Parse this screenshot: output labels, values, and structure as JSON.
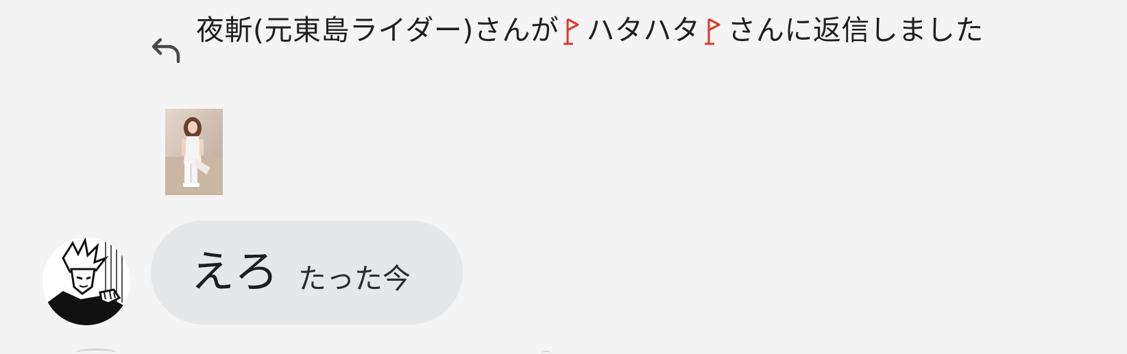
{
  "reply_notice": {
    "part1": "夜斬(元東島ライダー)さんが",
    "part2": "ハタハタ",
    "part3": "さんに返信しました",
    "icon": "reply-arrow-icon",
    "flag_icon": "red-flag-emoji-icon",
    "flag_color": "#e0352b"
  },
  "attachment": {
    "icon": "photo-thumbnail"
  },
  "message": {
    "text": "えろ",
    "time": "たった今",
    "bubble_color": "#e6e7e9",
    "avatar_icon": "manga-avatar"
  },
  "colors": {
    "background": "#f4f4f4",
    "text": "#1f1f1f"
  }
}
